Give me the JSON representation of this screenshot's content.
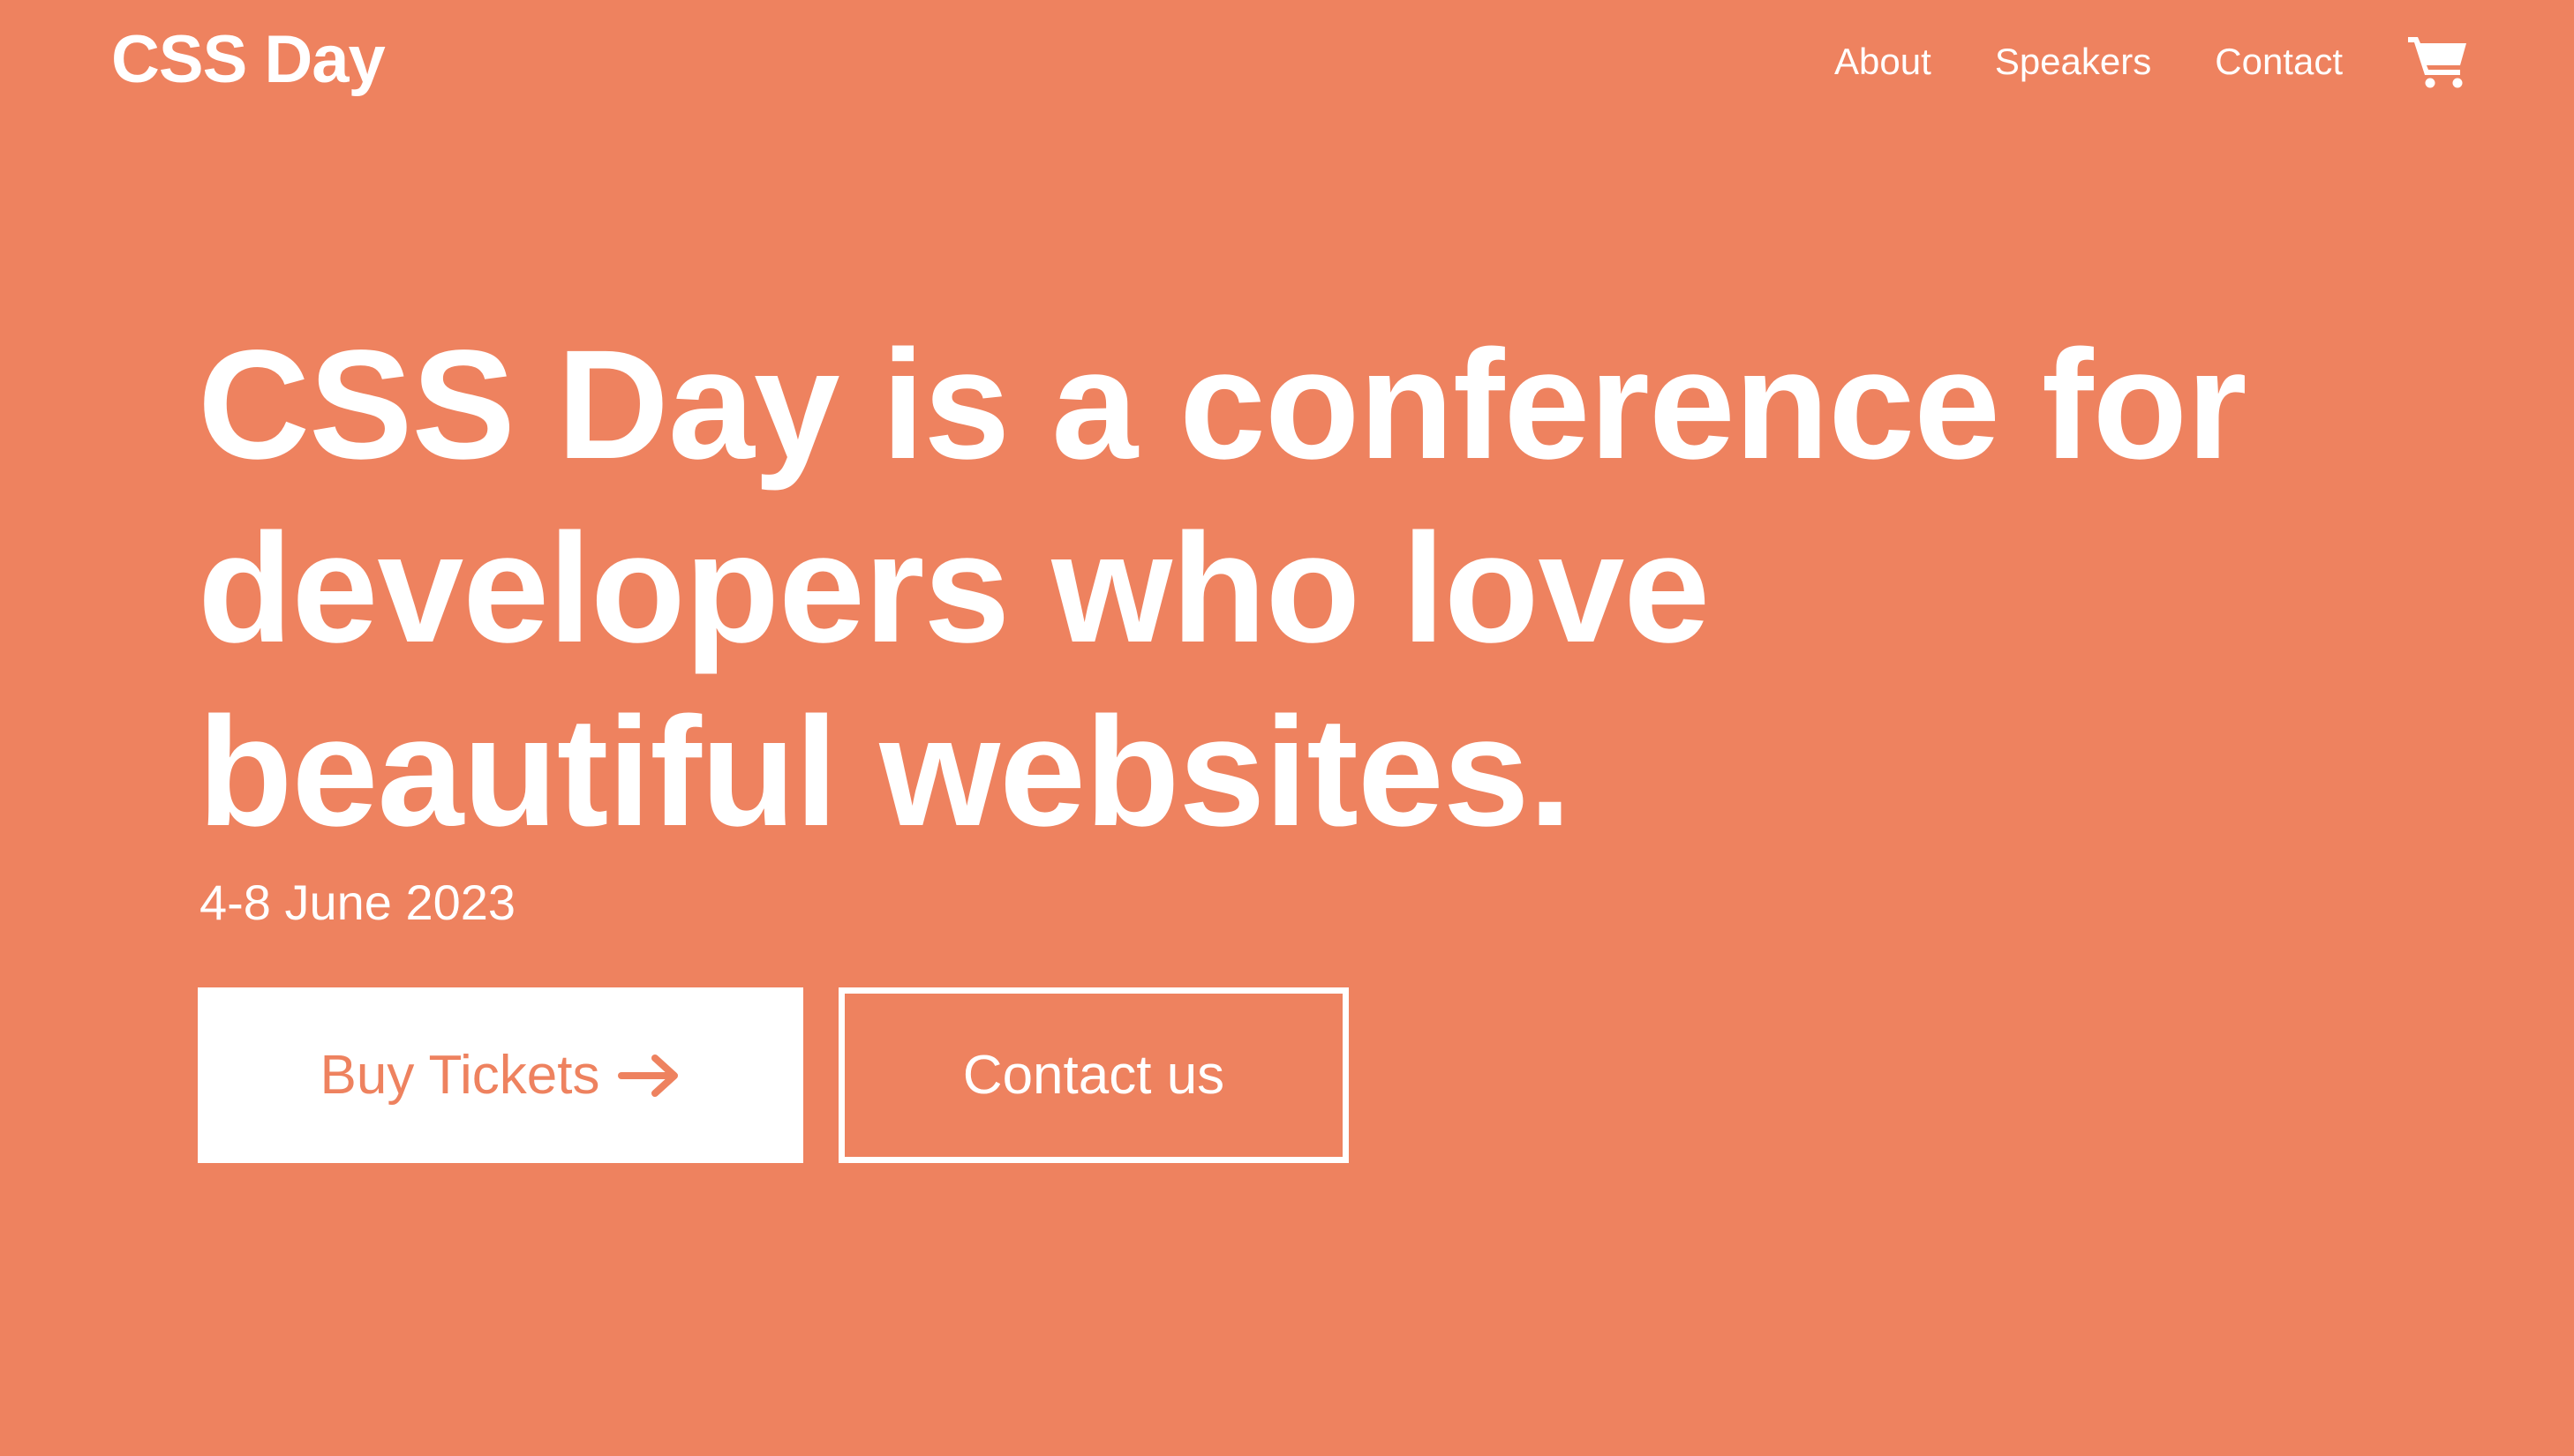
{
  "colors": {
    "background": "#EE825F",
    "foreground": "#FFFFFF"
  },
  "header": {
    "logo": "CSS Day",
    "nav": [
      {
        "label": "About"
      },
      {
        "label": "Speakers"
      },
      {
        "label": "Contact"
      }
    ],
    "cart_icon": "shopping-cart-icon"
  },
  "hero": {
    "headline": "CSS Day is a conference for developers who love beautiful websites.",
    "date": "4-8 June 2023",
    "primary_button": {
      "label": "Buy Tickets",
      "icon": "arrow-right-icon"
    },
    "secondary_button": {
      "label": "Contact us"
    }
  }
}
